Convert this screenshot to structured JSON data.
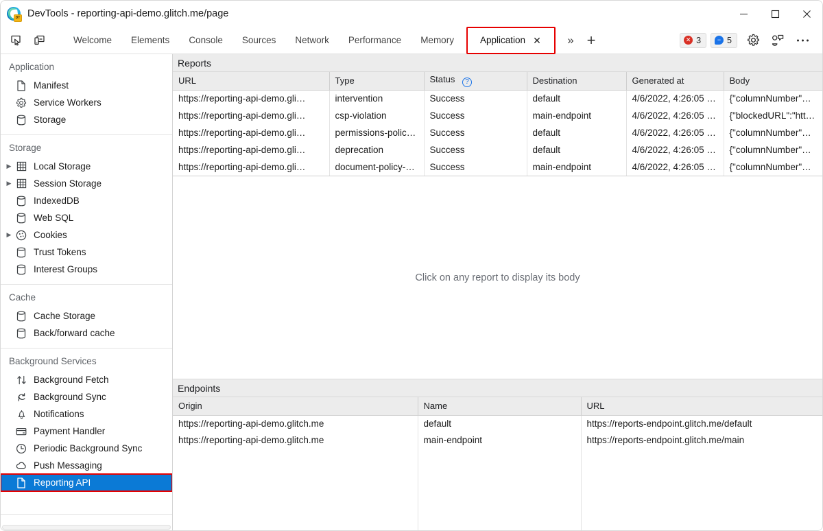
{
  "window": {
    "title": "DevTools - reporting-api-demo.glitch.me/page",
    "app_icon": "edge-devtools-icon",
    "badge_text": "DT",
    "controls": {
      "minimize": "−",
      "maximize": "□",
      "close": "✕"
    }
  },
  "toolbar": {
    "inspect_icon": "inspect-element-icon",
    "device_icon": "device-toolbar-icon",
    "tabs": [
      {
        "label": "Welcome",
        "active": false
      },
      {
        "label": "Elements",
        "active": false
      },
      {
        "label": "Console",
        "active": false
      },
      {
        "label": "Sources",
        "active": false
      },
      {
        "label": "Network",
        "active": false
      },
      {
        "label": "Performance",
        "active": false
      },
      {
        "label": "Memory",
        "active": false
      }
    ],
    "active_tab": {
      "label": "Application",
      "close_glyph": "✕"
    },
    "more_tabs_glyph": "»",
    "add_tab_glyph": "+",
    "error_count": "3",
    "message_count": "5",
    "error_color": "#d93025",
    "message_color": "#1a73e8",
    "settings_icon": "gear-icon",
    "customize_icon": "devtools-customize-icon",
    "more_icon": "more-options-icon"
  },
  "sidebar": {
    "groups": [
      {
        "title": "Application",
        "items": [
          {
            "label": "Manifest",
            "icon": "document-icon",
            "twisty": false,
            "selected": false
          },
          {
            "label": "Service Workers",
            "icon": "gear-icon",
            "twisty": false,
            "selected": false
          },
          {
            "label": "Storage",
            "icon": "database-icon",
            "twisty": false,
            "selected": false
          }
        ]
      },
      {
        "title": "Storage",
        "items": [
          {
            "label": "Local Storage",
            "icon": "table-icon",
            "twisty": true,
            "selected": false
          },
          {
            "label": "Session Storage",
            "icon": "table-icon",
            "twisty": true,
            "selected": false
          },
          {
            "label": "IndexedDB",
            "icon": "database-icon",
            "twisty": false,
            "selected": false
          },
          {
            "label": "Web SQL",
            "icon": "database-icon",
            "twisty": false,
            "selected": false
          },
          {
            "label": "Cookies",
            "icon": "cookie-icon",
            "twisty": true,
            "selected": false
          },
          {
            "label": "Trust Tokens",
            "icon": "database-icon",
            "twisty": false,
            "selected": false
          },
          {
            "label": "Interest Groups",
            "icon": "database-icon",
            "twisty": false,
            "selected": false
          }
        ]
      },
      {
        "title": "Cache",
        "items": [
          {
            "label": "Cache Storage",
            "icon": "database-icon",
            "twisty": false,
            "selected": false
          },
          {
            "label": "Back/forward cache",
            "icon": "database-icon",
            "twisty": false,
            "selected": false
          }
        ]
      },
      {
        "title": "Background Services",
        "items": [
          {
            "label": "Background Fetch",
            "icon": "arrows-updown-icon",
            "twisty": false,
            "selected": false
          },
          {
            "label": "Background Sync",
            "icon": "sync-icon",
            "twisty": false,
            "selected": false
          },
          {
            "label": "Notifications",
            "icon": "bell-icon",
            "twisty": false,
            "selected": false
          },
          {
            "label": "Payment Handler",
            "icon": "credit-card-icon",
            "twisty": false,
            "selected": false
          },
          {
            "label": "Periodic Background Sync",
            "icon": "clock-icon",
            "twisty": false,
            "selected": false
          },
          {
            "label": "Push Messaging",
            "icon": "cloud-icon",
            "twisty": false,
            "selected": false
          },
          {
            "label": "Reporting API",
            "icon": "document-icon",
            "twisty": false,
            "selected": true
          }
        ]
      }
    ],
    "selection_color": "#0b7ad6",
    "annotation_color": "#e60000"
  },
  "reports": {
    "section_label": "Reports",
    "columns": [
      "URL",
      "Type",
      "Status",
      "Destination",
      "Generated at",
      "Body"
    ],
    "status_help_glyph": "?",
    "rows": [
      {
        "url": "https://reporting-api-demo.gli…",
        "type": "intervention",
        "status": "Success",
        "destination": "default",
        "generated_at": "4/6/2022, 4:26:05 …",
        "body": "{\"columnNumber\"…"
      },
      {
        "url": "https://reporting-api-demo.gli…",
        "type": "csp-violation",
        "status": "Success",
        "destination": "main-endpoint",
        "generated_at": "4/6/2022, 4:26:05 …",
        "body": "{\"blockedURL\":\"htt…"
      },
      {
        "url": "https://reporting-api-demo.gli…",
        "type": "permissions-polic…",
        "status": "Success",
        "destination": "default",
        "generated_at": "4/6/2022, 4:26:05 …",
        "body": "{\"columnNumber\"…"
      },
      {
        "url": "https://reporting-api-demo.gli…",
        "type": "deprecation",
        "status": "Success",
        "destination": "default",
        "generated_at": "4/6/2022, 4:26:05 …",
        "body": "{\"columnNumber\"…"
      },
      {
        "url": "https://reporting-api-demo.gli…",
        "type": "document-policy-…",
        "status": "Success",
        "destination": "main-endpoint",
        "generated_at": "4/6/2022, 4:26:05 …",
        "body": "{\"columnNumber\"…"
      }
    ]
  },
  "report_body_pane": {
    "placeholder": "Click on any report to display its body"
  },
  "endpoints": {
    "section_label": "Endpoints",
    "columns": [
      "Origin",
      "Name",
      "URL"
    ],
    "rows": [
      {
        "origin": "https://reporting-api-demo.glitch.me",
        "name": "default",
        "url": "https://reports-endpoint.glitch.me/default"
      },
      {
        "origin": "https://reporting-api-demo.glitch.me",
        "name": "main-endpoint",
        "url": "https://reports-endpoint.glitch.me/main"
      }
    ]
  }
}
